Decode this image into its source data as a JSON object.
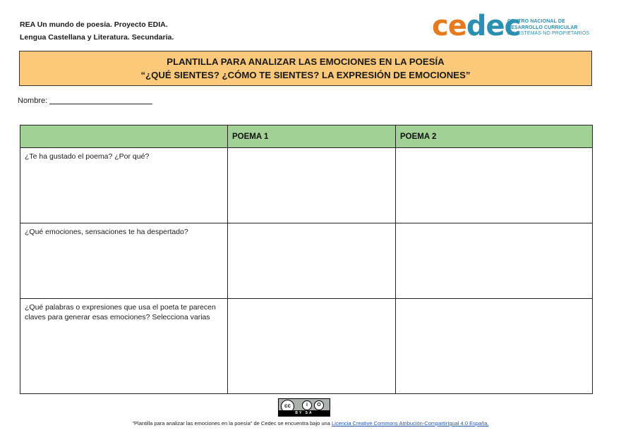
{
  "header": {
    "line1": "REA Un mundo de poesía. Proyecto EDIA.",
    "line2": "Lengua Castellana y Literatura. Secundaria."
  },
  "logo": {
    "word_part1": "ce",
    "word_part2": "dec",
    "tagline_line1": "CENTRO NACIONAL DE",
    "tagline_line2": "DESARROLLO CURRICULAR",
    "tagline_line3": "EN SISTEMAS NO PROPIETARIOS",
    "colors": {
      "orange": "#e57a1f",
      "blue": "#2a8fb0"
    }
  },
  "title": {
    "line1": "PLANTILLA PARA ANALIZAR LAS EMOCIONES EN LA POESÍA",
    "line2": "“¿QUÉ SIENTES? ¿CÓMO TE SIENTES? LA EXPRESIÓN DE EMOCIONES”",
    "background": "#fcc97a"
  },
  "form": {
    "nombre_label": "Nombre:"
  },
  "table": {
    "header_color": "#a1d195",
    "columns": [
      "",
      "POEMA 1",
      "POEMA 2"
    ],
    "rows": [
      {
        "question": "¿Te ha gustado el poema? ¿Por qué?",
        "poema1": "",
        "poema2": ""
      },
      {
        "question": "¿Qué emociones, sensaciones te ha despertado?",
        "poema1": "",
        "poema2": ""
      },
      {
        "question": "¿Qué palabras o expresiones que usa el poeta te parecen claves para generar esas emociones? Selecciona varias",
        "poema1": "",
        "poema2": ""
      }
    ]
  },
  "license": {
    "badge_cc": "cc",
    "badge_by": "i",
    "badge_sa": "O",
    "badge_band": "BY SA",
    "text_prefix": "\"Plantilla para analizar las emociones en la poesía\" de Cedec se encuentra bajo una ",
    "link_text": "Licencia Creative Commons Atribución-CompartirIgual 4.0 España."
  }
}
